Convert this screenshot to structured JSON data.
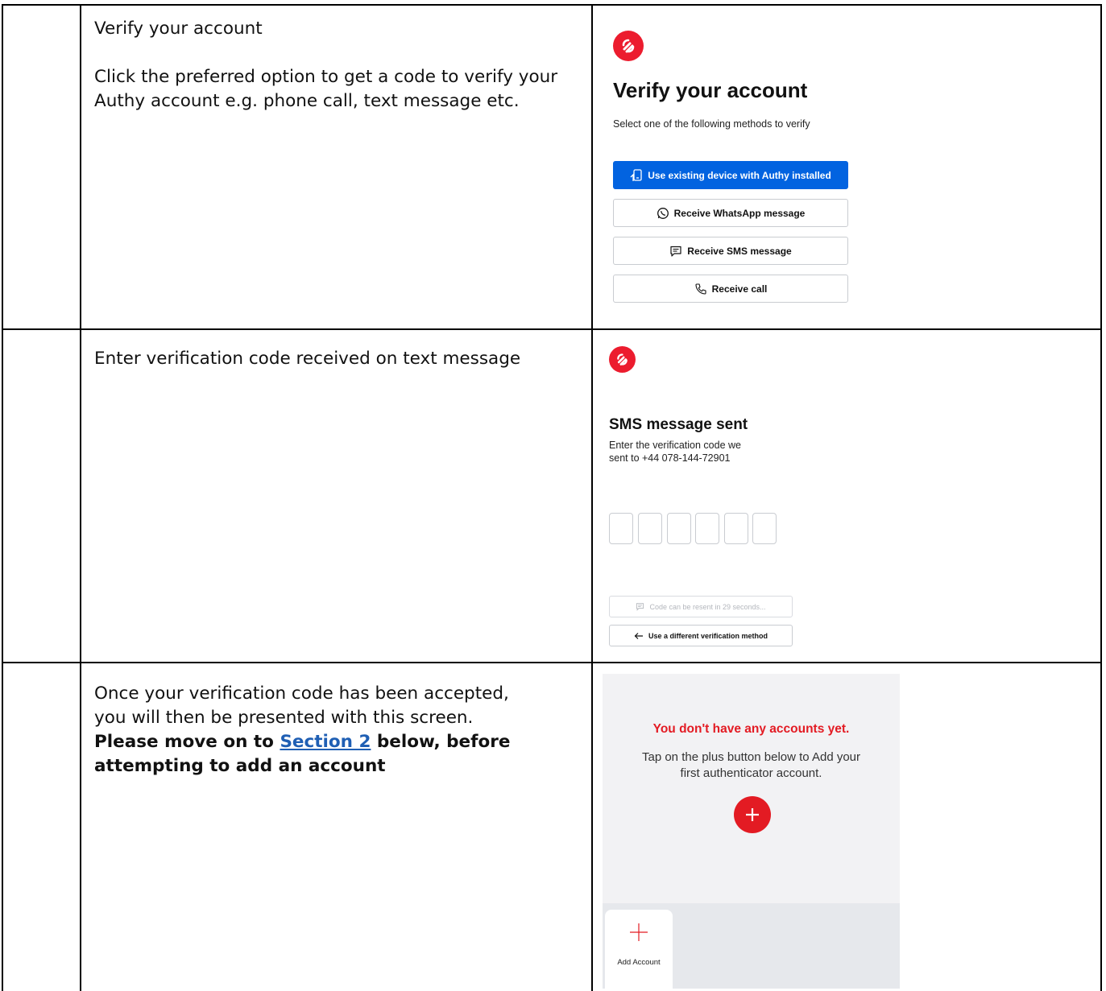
{
  "rows": [
    {
      "instruction_title": "Verify your account",
      "instruction_body": "Click the preferred option to get a code to verify your Authy account e.g. phone call, text message etc.",
      "screen": {
        "logo": "authy-logo-icon",
        "title": "Verify your account",
        "subtitle": "Select one of the following methods to verify",
        "buttons": [
          {
            "label": "Use existing device with Authy installed",
            "icon": "device-icon",
            "style": "primary"
          },
          {
            "label": "Receive WhatsApp message",
            "icon": "whatsapp-icon",
            "style": "outline"
          },
          {
            "label": "Receive SMS message",
            "icon": "sms-icon",
            "style": "outline"
          },
          {
            "label": "Receive call",
            "icon": "phone-icon",
            "style": "outline"
          }
        ]
      }
    },
    {
      "instruction_title": "Enter verification code received on text message",
      "screen": {
        "logo": "authy-logo-icon",
        "title": "SMS message sent",
        "subtitle_line1": "Enter the verification code we",
        "subtitle_line2": "sent to +44 078-144-72901",
        "code_digits": 6,
        "resend_label": "Code can be resent in 29 seconds...",
        "different_method_label": "Use a different verification method"
      }
    },
    {
      "instruction_line1": "Once your verification code has been accepted,",
      "instruction_line2": "you will then be presented with this screen.",
      "bold_prefix": "Please move on to ",
      "link_text": "Section 2",
      "bold_suffix": " below, before",
      "bold_line2": "attempting to add an account",
      "screen": {
        "empty_title": "You don't have any accounts yet.",
        "empty_body_line1": "Tap on the plus button below to Add your",
        "empty_body_line2": "first authenticator account.",
        "add_account_label": "Add Account"
      }
    }
  ],
  "colors": {
    "authy_red": "#ec1c2e",
    "primary_blue": "#0263e0",
    "empty_title_red": "#e31b23",
    "link_blue": "#1f5fb4"
  }
}
